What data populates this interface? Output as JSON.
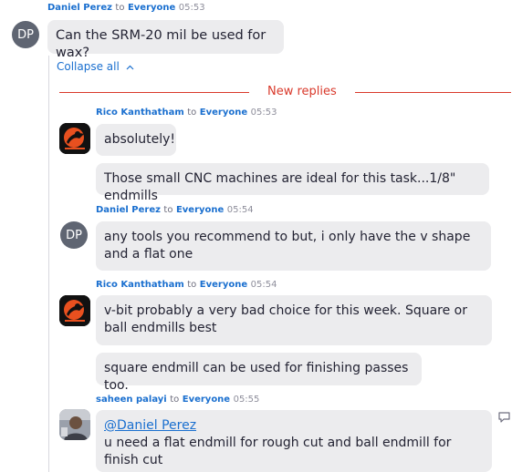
{
  "root": {
    "author": "Daniel Perez",
    "to": "to",
    "target": "Everyone",
    "time": "05:53",
    "initials": "DP",
    "text": "Can the SRM-20 mil be used for wax?"
  },
  "thread": {
    "collapse_label": "Collapse all",
    "new_replies_label": "New replies"
  },
  "replies": [
    {
      "author": "Rico Kanthatham",
      "to": "to",
      "target": "Everyone",
      "time": "05:53",
      "messages": [
        "absolutely!",
        "Those small CNC machines are ideal for this task...1/8\" endmills"
      ]
    },
    {
      "author": "Daniel Perez",
      "to": "to",
      "target": "Everyone",
      "time": "05:54",
      "initials": "DP",
      "messages": [
        "any tools you recommend to but, i only have the v shape and a flat one"
      ]
    },
    {
      "author": "Rico Kanthatham",
      "to": "to",
      "target": "Everyone",
      "time": "05:54",
      "messages": [
        "v-bit probably a very bad choice for this week. Square or ball endmills best",
        "square endmill can be used for finishing passes too."
      ]
    },
    {
      "author": "saheen palayi",
      "to": "to",
      "target": "Everyone",
      "time": "05:55",
      "mention": "@Daniel Perez",
      "messages": [
        "u need a flat endmill for rough cut and ball endmill for finish cut"
      ]
    }
  ],
  "colors": {
    "accent": "#1a6fcf",
    "new_replies": "#d9392b",
    "bubble": "#ececee"
  }
}
